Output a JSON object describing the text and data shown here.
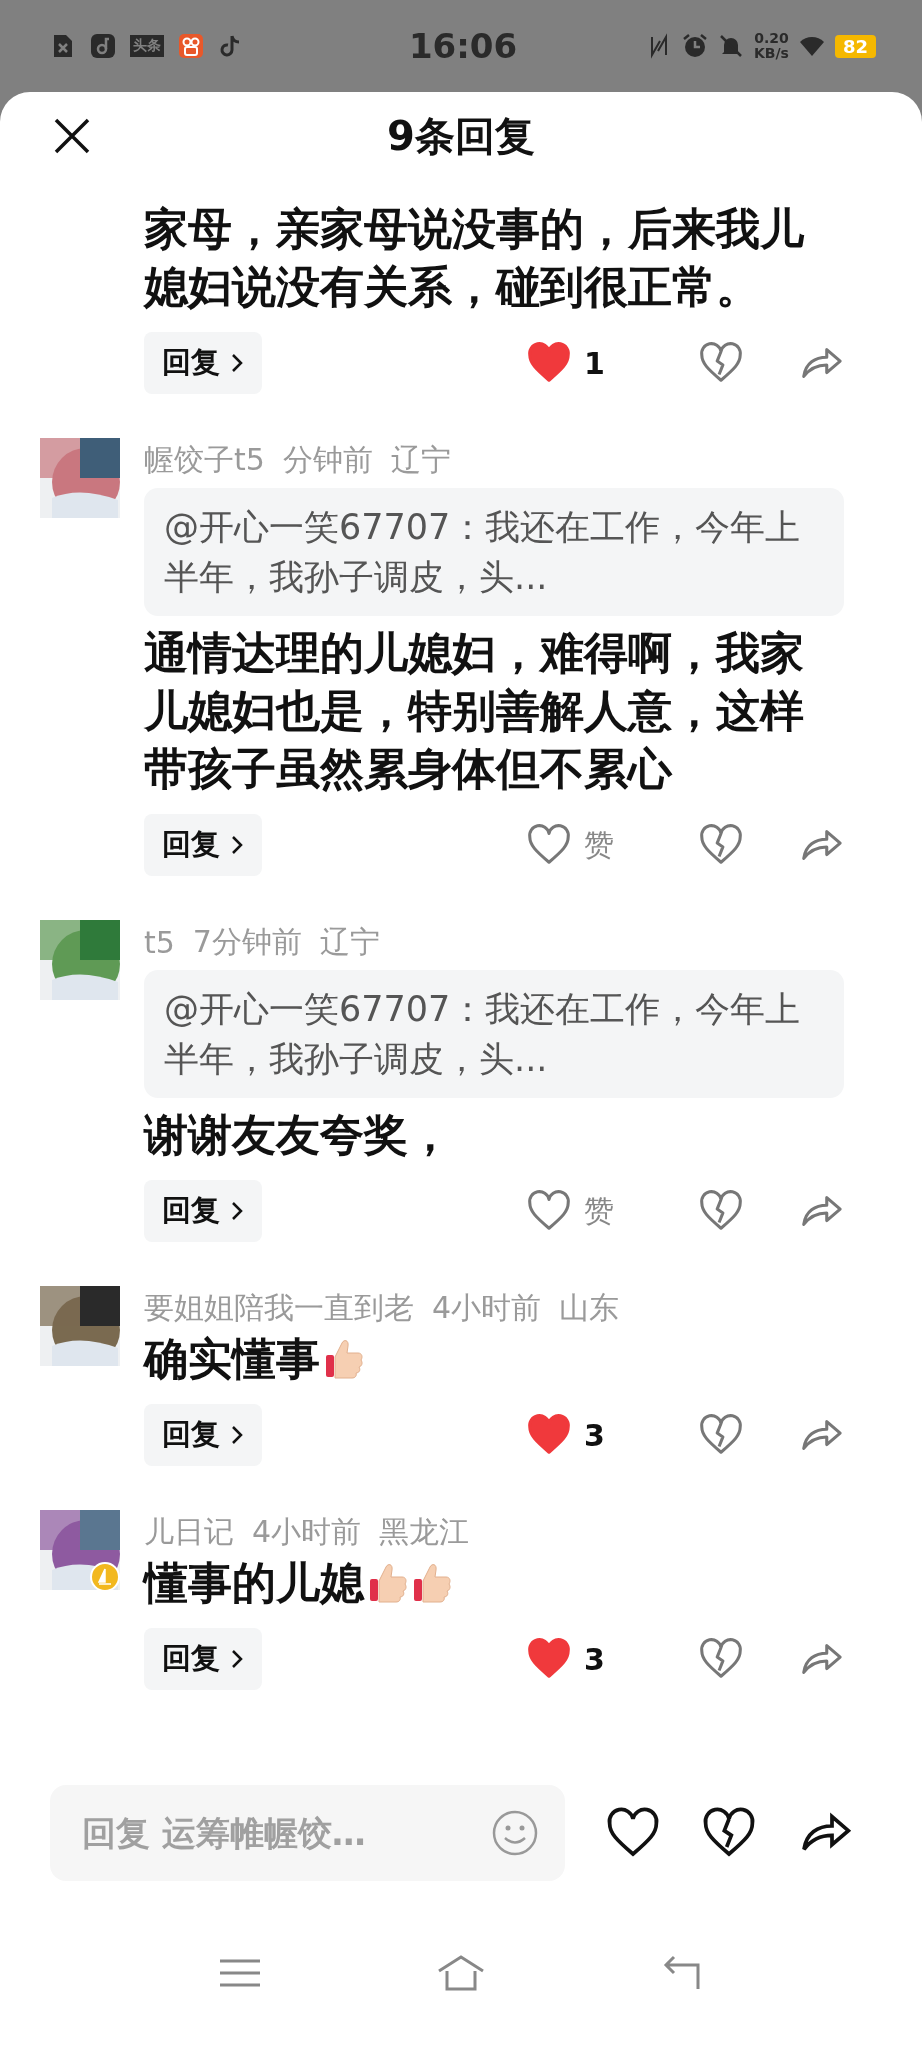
{
  "status_bar": {
    "time": "16:06",
    "app_badge": "头条",
    "net_speed": "0.20",
    "net_unit": "KB/s",
    "battery": "82"
  },
  "header": {
    "title": "9条回复"
  },
  "comments": [
    {
      "kind": "continued",
      "text": "家母，亲家母说没事的，后来我儿媳妇说没有关系，碰到很正常。",
      "reply_label": "回复",
      "liked": true,
      "like_label": "1"
    },
    {
      "kind": "full",
      "name": "幄饺子t5",
      "time": "分钟前",
      "region": "辽宁",
      "badge": false,
      "quote": "@开心一笑67707：我还在工作，今年上半年，我孙子调皮，头...",
      "text": "通情达理的儿媳妇，难得啊，我家儿媳妇也是，特别善解人意，这样带孩子虽然累身体但不累心",
      "reply_label": "回复",
      "liked": false,
      "like_label": "赞"
    },
    {
      "kind": "full",
      "name": "t5",
      "time": "7分钟前",
      "region": "辽宁",
      "badge": false,
      "quote": "@开心一笑67707：我还在工作，今年上半年，我孙子调皮，头...",
      "text": "谢谢友友夸奖，",
      "reply_label": "回复",
      "liked": false,
      "like_label": "赞"
    },
    {
      "kind": "full",
      "name": "要姐姐陪我一直到老",
      "time": "4小时前",
      "region": "山东",
      "badge": false,
      "text": "确实懂事",
      "emojis": [
        {
          "kind": "thumbs_up"
        }
      ],
      "reply_label": "回复",
      "liked": true,
      "like_label": "3"
    },
    {
      "kind": "full",
      "name": "儿日记",
      "time": "4小时前",
      "region": "黑龙江",
      "badge": true,
      "text": "懂事的儿媳",
      "emojis": [
        {
          "kind": "thumbs_up"
        },
        {
          "kind": "thumbs_up"
        }
      ],
      "reply_label": "回复",
      "liked": true,
      "like_label": "3"
    }
  ],
  "composer": {
    "placeholder": "回复 运筹帷幄饺…"
  }
}
